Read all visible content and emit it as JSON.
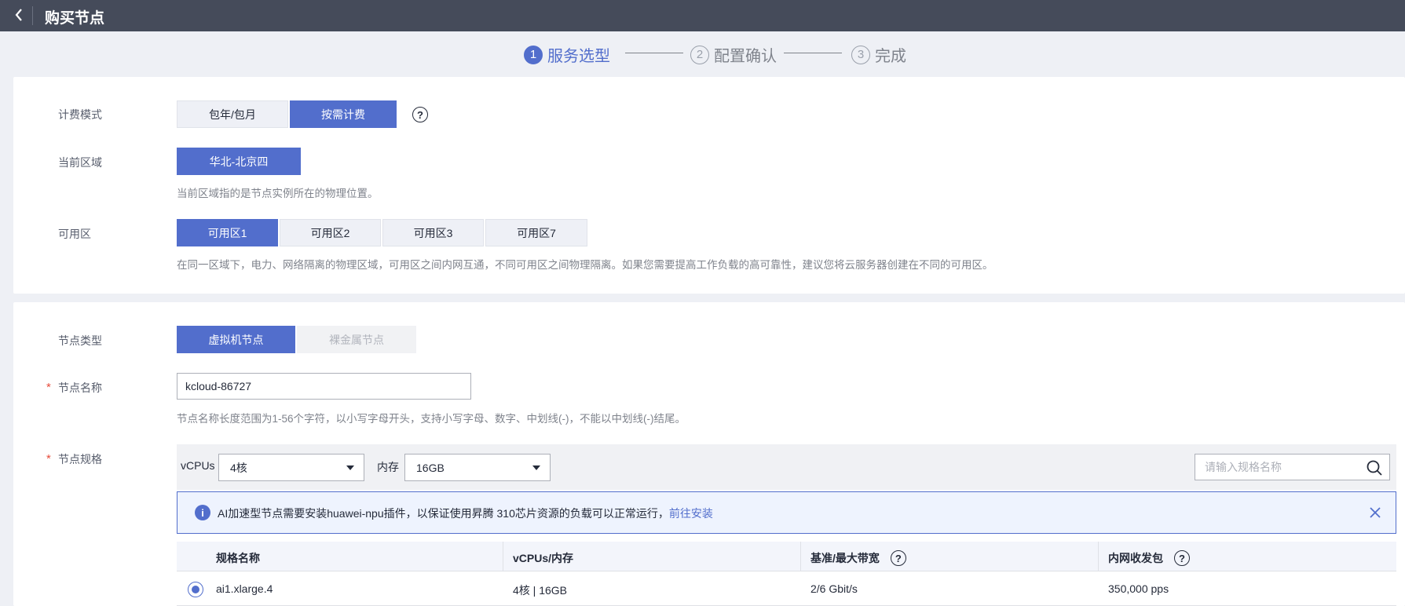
{
  "header": {
    "title": "购买节点"
  },
  "steps": [
    {
      "num": "1",
      "label": "服务选型"
    },
    {
      "num": "2",
      "label": "配置确认"
    },
    {
      "num": "3",
      "label": "完成"
    }
  ],
  "billing": {
    "label": "计费模式",
    "options": [
      "包年/包月",
      "按需计费"
    ],
    "selected": "按需计费"
  },
  "region": {
    "label": "当前区域",
    "value": "华北-北京四",
    "hint": "当前区域指的是节点实例所在的物理位置。"
  },
  "az": {
    "label": "可用区",
    "options": [
      "可用区1",
      "可用区2",
      "可用区3",
      "可用区7"
    ],
    "selected": "可用区1",
    "hint": "在同一区域下，电力、网络隔离的物理区域，可用区之间内网互通，不同可用区之间物理隔离。如果您需要提高工作负载的高可靠性，建议您将云服务器创建在不同的可用区。"
  },
  "node_type": {
    "label": "节点类型",
    "options": [
      "虚拟机节点",
      "裸金属节点"
    ],
    "selected": "虚拟机节点"
  },
  "node_name": {
    "required_mark": "*",
    "label": "节点名称",
    "value": "kcloud-86727",
    "hint": "节点名称长度范围为1-56个字符，以小写字母开头，支持小写字母、数字、中划线(-)，不能以中划线(-)结尾。"
  },
  "node_spec": {
    "required_mark": "*",
    "label": "节点规格",
    "vcpus_label": "vCPUs",
    "vcpus_value": "4核",
    "memory_label": "内存",
    "memory_value": "16GB",
    "search_placeholder": "请输入规格名称"
  },
  "alert": {
    "text": "AI加速型节点需要安装huawei-npu插件，以保证使用昇腾 310芯片资源的负载可以正常运行，",
    "link": "前往安装"
  },
  "table": {
    "headers": [
      "规格名称",
      "vCPUs/内存",
      "基准/最大带宽",
      "内网收发包"
    ],
    "rows": [
      [
        "ai1.xlarge.4",
        "4核 | 16GB",
        "2/6 Gbit/s",
        "350,000 pps"
      ]
    ]
  },
  "colors": {
    "primary": "#526ecc",
    "topbar": "#454b5a",
    "background": "#eef0f5"
  },
  "icons": {
    "back": "chevron-left-icon",
    "help": "question-circle-icon",
    "info": "info-circle-icon",
    "close": "close-icon",
    "search": "search-icon"
  }
}
